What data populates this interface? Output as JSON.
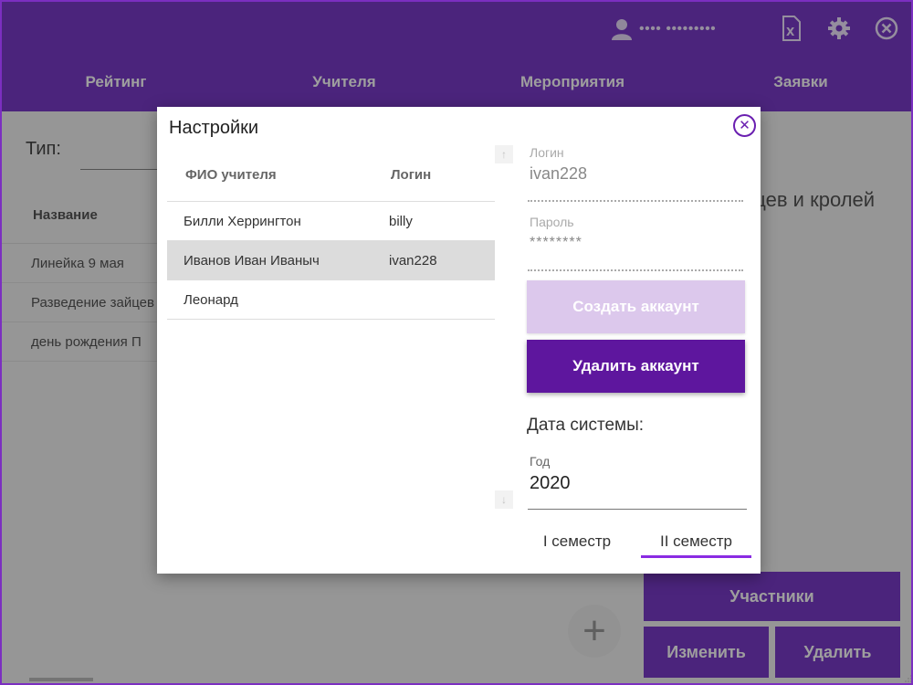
{
  "colors": {
    "accent": "#7a3bc8",
    "accent_dark": "#5e169e",
    "accent_light": "#dcc8ec",
    "underline": "#8a2be2"
  },
  "header": {
    "user_name": "•••• •••••••••",
    "icons": [
      "user-icon",
      "excel-icon",
      "gear-icon",
      "close-icon"
    ],
    "nav": [
      "Рейтинг",
      "Учителя",
      "Мероприятия",
      "Заявки"
    ]
  },
  "background": {
    "type_label": "Тип:",
    "table_header": "Название",
    "events": [
      "Линейка 9 мая",
      "Разведение зайцев",
      "день рождения  П"
    ],
    "right_text": "йцев и кролей",
    "buttons": {
      "participants": "Участники",
      "edit": "Изменить",
      "delete": "Удалить"
    },
    "plus": "+"
  },
  "dialog": {
    "title": "Настройки",
    "teachers": {
      "columns": [
        "ФИО учителя",
        "Логин"
      ],
      "rows": [
        {
          "name": "Билли Херрингтон",
          "login": "billy"
        },
        {
          "name": "Иванов Иван Иваныч",
          "login": "ivan228"
        },
        {
          "name": "Леонард",
          "login": ""
        }
      ],
      "selected_index": 1
    },
    "login_label": "Логин",
    "login_value": "ivan228",
    "password_label": "Пароль",
    "password_value": "********",
    "create_button": "Создать аккаунт",
    "delete_button": "Удалить аккаунт",
    "system_date": "Дата системы:",
    "year_label": "Год",
    "year_value": "2020",
    "semesters": [
      "I семестр",
      "II семестр"
    ],
    "selected_semester": 1
  }
}
